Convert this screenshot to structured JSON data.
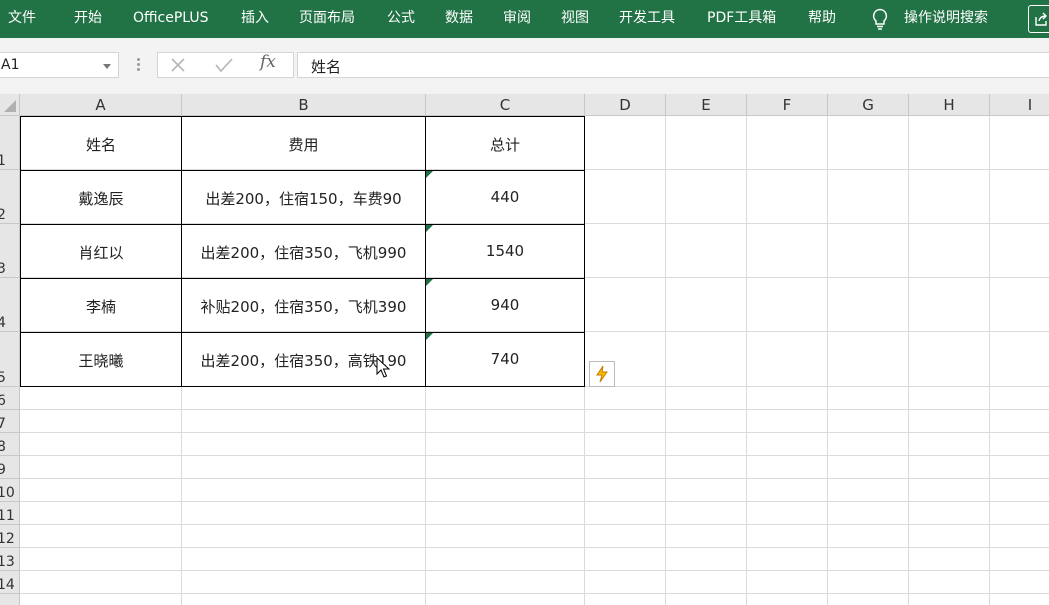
{
  "ribbon": {
    "tabs": [
      "文件",
      "开始",
      "OfficePLUS",
      "插入",
      "页面布局",
      "公式",
      "数据",
      "审阅",
      "视图",
      "开发工具",
      "PDF工具箱",
      "帮助"
    ],
    "tell_me": "操作说明搜索",
    "color": "#217346"
  },
  "formula_bar": {
    "name_box": "A1",
    "formula": "姓名"
  },
  "sheet": {
    "columns": [
      "A",
      "B",
      "C",
      "D",
      "E",
      "F",
      "G",
      "H",
      "I"
    ],
    "rows": [
      "1",
      "2",
      "3",
      "4",
      "5",
      "6",
      "7",
      "8",
      "9",
      "10",
      "11",
      "12",
      "13",
      "14"
    ],
    "header": [
      "姓名",
      "费用",
      "总计"
    ],
    "data": [
      [
        "戴逸辰",
        "出差200，住宿150，车费90",
        "440"
      ],
      [
        "肖红以",
        "出差200，住宿350，飞机990",
        "1540"
      ],
      [
        "李楠",
        "补贴200，住宿350，飞机390",
        "940"
      ],
      [
        "王晓曦",
        "出差200，住宿350，高铁190",
        "740"
      ]
    ],
    "error_indicator_color": "#1e7145"
  },
  "icons": {
    "tell_me": "lightbulb-icon",
    "share": "share-icon",
    "cancel": "cancel-x-icon",
    "enter": "checkmark-icon",
    "flash_fill": "lightning-icon",
    "cursor": "mouse-pointer-icon"
  }
}
